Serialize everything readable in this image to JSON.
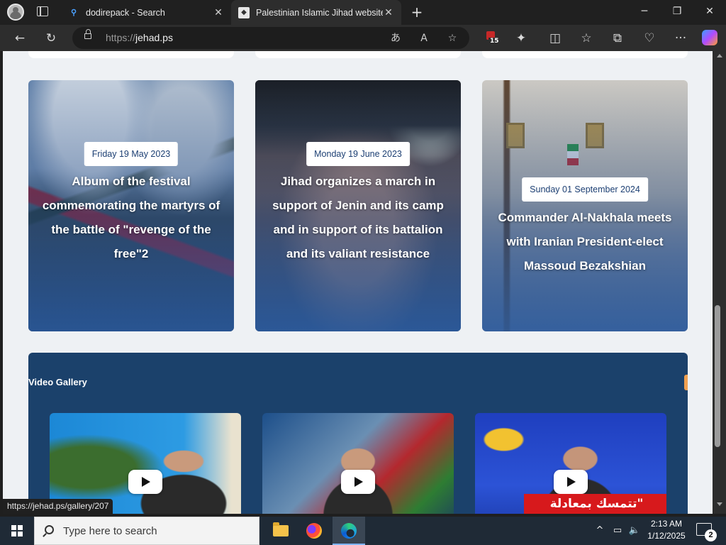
{
  "browser": {
    "tabs": [
      {
        "title": "dodirepack - Search",
        "icon": "search-icon",
        "active": false
      },
      {
        "title": "Palestinian Islamic Jihad website",
        "icon": "pij-favicon",
        "active": true
      }
    ],
    "new_tab_label": "+",
    "window_controls": {
      "minimize": "─",
      "restore": "❐",
      "close": "✕"
    },
    "url_scheme": "https://",
    "url_host": "jehad.ps",
    "extension_badge": "15",
    "nav_icons": {
      "back": "←",
      "refresh": "↻"
    },
    "omnibox_icons": {
      "translate": "あ",
      "read_aloud": "A",
      "favorite": "☆"
    },
    "toolbar_icons": {
      "extensions": "✦",
      "split_screen": "◫",
      "favorites": "☆",
      "collections": "⧉",
      "performance": "♡",
      "more": "···"
    }
  },
  "page": {
    "news_cards": [
      {
        "date": "Friday 19 May 2023",
        "title": "Album of the festival commemorating the martyrs of the battle of \"revenge of the free\"2"
      },
      {
        "date": "Monday 19 June 2023",
        "title": "Jihad organizes a march in support of Jenin and its camp and in support of its battalion and its valiant resistance"
      },
      {
        "date": "Sunday 01 September 2024",
        "title": "Commander Al-Nakhala meets with Iranian President-elect Massoud Bezakshian"
      }
    ],
    "video_gallery": {
      "heading": "Video Gallery",
      "videos": [
        {
          "arabic_caption": ""
        },
        {
          "arabic_caption": ""
        },
        {
          "arabic_caption": "\"تتمسك بمعادلة"
        }
      ]
    }
  },
  "status_bar_url": "https://jehad.ps/gallery/207",
  "taskbar": {
    "search_placeholder": "Type here to search",
    "apps": [
      "file-explorer-icon",
      "firefox-icon",
      "edge-icon"
    ],
    "time": "2:13 AM",
    "date": "1/12/2025",
    "notification_count": "2",
    "tray_icons": {
      "chevron": "^",
      "network": "▭",
      "volume": "🔈"
    }
  },
  "colors": {
    "video_section_bg": "#1b416b",
    "date_text": "#1c3f73",
    "accent_orange": "#f0a050"
  }
}
